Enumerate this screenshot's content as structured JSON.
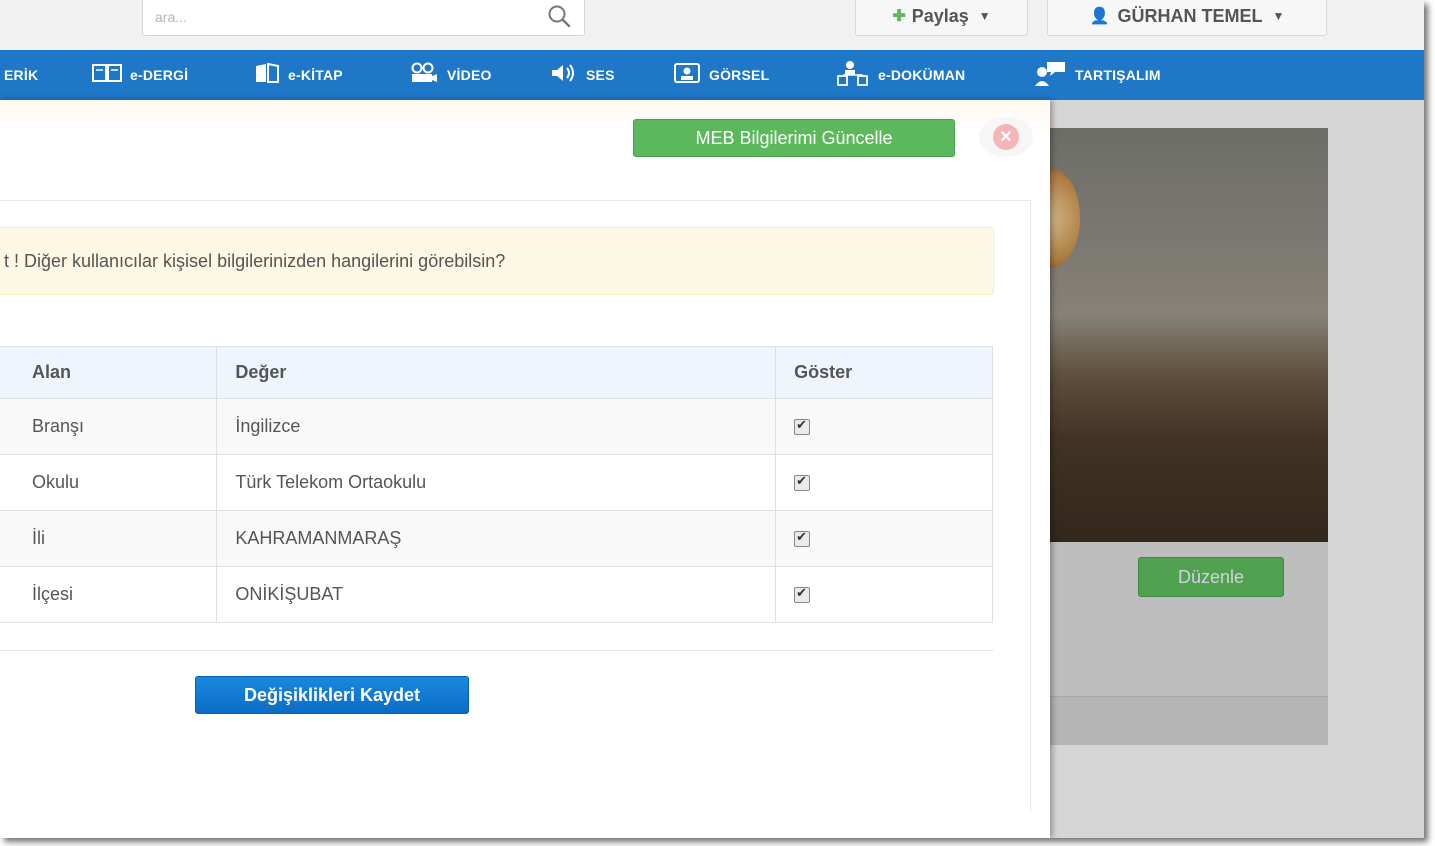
{
  "header": {
    "search_placeholder": "ara...",
    "share_label": "Paylaş",
    "user_label": "GÜRHAN TEMEL"
  },
  "nav": {
    "items": [
      {
        "label": "ERİK",
        "icon": "none"
      },
      {
        "label": "e-DERGİ",
        "icon": "magazine-icon"
      },
      {
        "label": "e-KİTAP",
        "icon": "book-icon"
      },
      {
        "label": "VİDEO",
        "icon": "video-icon"
      },
      {
        "label": "SES",
        "icon": "speaker-icon"
      },
      {
        "label": "GÖRSEL",
        "icon": "image-icon"
      },
      {
        "label": "e-DOKÜMAN",
        "icon": "document-icon"
      },
      {
        "label": "TARTIŞALIM",
        "icon": "discussion-icon"
      }
    ]
  },
  "modal": {
    "meb_button": "MEB Bilgilerimi Güncelle",
    "alert_text": "t ! Diğer kullanıcılar kişisel bilgilerinizden hangilerini görebilsin?",
    "table": {
      "headers": [
        "Alan",
        "Değer",
        "Göster"
      ],
      "rows": [
        {
          "field": "Branşı",
          "value": "İngilizce",
          "show": true
        },
        {
          "field": "Okulu",
          "value": "Türk Telekom Ortaokulu",
          "show": true
        },
        {
          "field": "İli",
          "value": "KAHRAMANMARAŞ",
          "show": true
        },
        {
          "field": "İlçesi",
          "value": "ONİKİŞUBAT",
          "show": true
        }
      ]
    },
    "save_button": "Değişiklikleri Kaydet"
  },
  "background": {
    "edit_button": "Düzenle"
  },
  "colors": {
    "nav_blue": "#1f77c7",
    "green": "#5cb85c",
    "alert_bg": "#fcf8e3",
    "primary_blue": "#0b6cc5"
  }
}
